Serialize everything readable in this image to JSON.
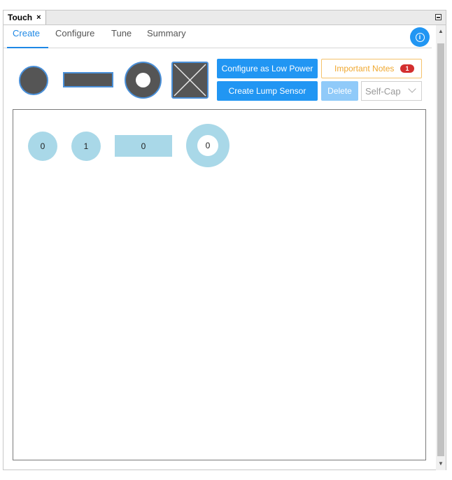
{
  "view": {
    "title": "Touch",
    "close_symbol": "×"
  },
  "tabs": [
    {
      "label": "Create",
      "active": true
    },
    {
      "label": "Configure",
      "active": false
    },
    {
      "label": "Tune",
      "active": false
    },
    {
      "label": "Summary",
      "active": false
    }
  ],
  "info_button": {
    "icon": "info-icon",
    "symbol": "i"
  },
  "palette": [
    {
      "kind": "button",
      "icon": "button-shape-icon"
    },
    {
      "kind": "slider",
      "icon": "slider-shape-icon"
    },
    {
      "kind": "wheel",
      "icon": "wheel-shape-icon"
    },
    {
      "kind": "surface",
      "icon": "surface-shape-icon"
    }
  ],
  "actions": {
    "low_power_label": "Configure as Low Power",
    "lump_label": "Create Lump Sensor",
    "delete_label": "Delete",
    "notes_label": "Important Notes",
    "notes_count": "1",
    "mode_value": "Self-Cap"
  },
  "canvas": {
    "sensors": [
      {
        "type": "button",
        "label": "0"
      },
      {
        "type": "button",
        "label": "1"
      },
      {
        "type": "slider",
        "label": "0"
      },
      {
        "type": "wheel",
        "label": "0"
      }
    ]
  },
  "colors": {
    "accent": "#2196f3",
    "accent_disabled": "#90caf9",
    "shape_fill": "#555555",
    "sensor_fill": "#a9d8e8",
    "notes": "#f0a830",
    "badge": "#d32f2f"
  }
}
